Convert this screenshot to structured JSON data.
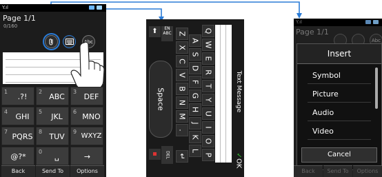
{
  "phone1": {
    "page_label": "Page 1/1",
    "char_count": "0/160",
    "attach_icon": "paperclip-icon",
    "keyboard_icon": "keyboard-icon",
    "abc_label": "Abc",
    "keys": [
      {
        "digit": "1",
        "label": ".?!"
      },
      {
        "digit": "2",
        "label": "ABC"
      },
      {
        "digit": "3",
        "label": "DEF"
      },
      {
        "digit": "4",
        "label": "GHI"
      },
      {
        "digit": "5",
        "label": "JKL"
      },
      {
        "digit": "6",
        "label": "MNO"
      },
      {
        "digit": "7",
        "label": "PQRS"
      },
      {
        "digit": "8",
        "label": "TUV"
      },
      {
        "digit": "9",
        "label": "WXYZ"
      },
      {
        "digit": "",
        "label": "@?*"
      },
      {
        "digit": "0",
        "label": "␣"
      },
      {
        "digit": "",
        "label": "→"
      }
    ],
    "softkeys": [
      "Back",
      "Send To",
      "Options"
    ]
  },
  "phone2": {
    "title": "Text Message",
    "mode_label": "EN\nABC",
    "space_label": "Space",
    "del_label": "DEL",
    "ok_label": "OK",
    "rows": [
      [
        "Q",
        "W",
        "E",
        "R",
        "T",
        "Y",
        "U",
        "I",
        "O",
        "P"
      ],
      [
        "A",
        "S",
        "D",
        "F",
        "G",
        "H",
        "J",
        "K",
        "L"
      ],
      [
        "Z",
        "X",
        "C",
        "V",
        "B",
        "N",
        "M",
        ".",
        "↵"
      ]
    ]
  },
  "phone3": {
    "page_label": "Page 1/1",
    "abc_label": "Abc",
    "menu_title": "Insert",
    "menu_items": [
      "Symbol",
      "Picture",
      "Audio",
      "Video"
    ],
    "cancel_label": "Cancel",
    "softkeys": [
      "Back",
      "Send To",
      "Options"
    ]
  },
  "colors": {
    "arrow": "#2a7bd6",
    "highlight": "#2a7bd6"
  }
}
